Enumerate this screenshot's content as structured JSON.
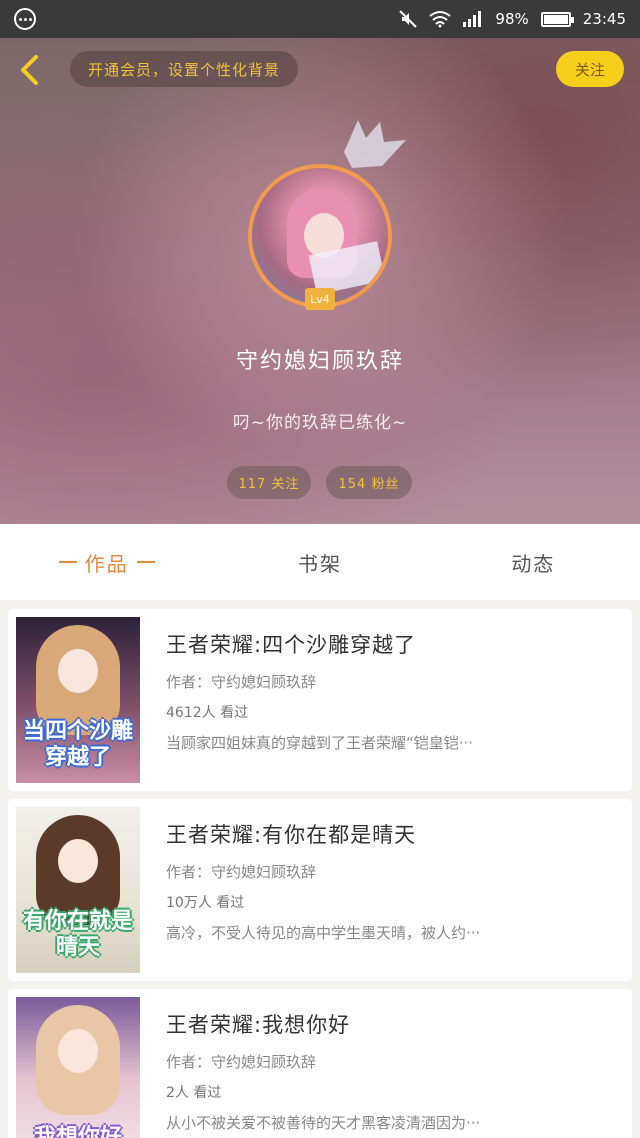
{
  "status_bar": {
    "battery": "98%",
    "time": "23:45",
    "battery_level": 0.98
  },
  "header": {
    "vip_prompt": "开通会员，设置个性化背景",
    "follow_label": "关注",
    "username": "守约媳妇顾玖辞",
    "level": "Lv4",
    "signature": "叼~你的玖辞已练化~",
    "following": "117 关注",
    "fans": "154 粉丝"
  },
  "tabs": [
    {
      "label": "作品",
      "active": true
    },
    {
      "label": "书架",
      "active": false
    },
    {
      "label": "动态",
      "active": false
    }
  ],
  "books": [
    {
      "title": "王者荣耀:四个沙雕穿越了",
      "author": "作者：守约媳妇顾玖辞",
      "views": "4612人 看过",
      "desc": "当顾家四姐妹真的穿越到了王者荣耀“铠皇铠···",
      "cover_text": "当四个沙雕穿越了",
      "cover_color": "#6b3a52"
    },
    {
      "title": "王者荣耀:有你在都是晴天",
      "author": "作者：守约媳妇顾玖辞",
      "views": "10万人 看过",
      "desc": "高冷，不受人待见的高中学生墨天晴，被人约···",
      "cover_text": "有你在就是晴天",
      "cover_color": "#5a4030"
    },
    {
      "title": "王者荣耀:我想你好",
      "author": "作者：守约媳妇顾玖辞",
      "views": "2人 看过",
      "desc": "从小不被关爱不被善待的天才黑客凌清酒因为···",
      "cover_text": "我想你好",
      "cover_color": "#c89aa8"
    }
  ]
}
